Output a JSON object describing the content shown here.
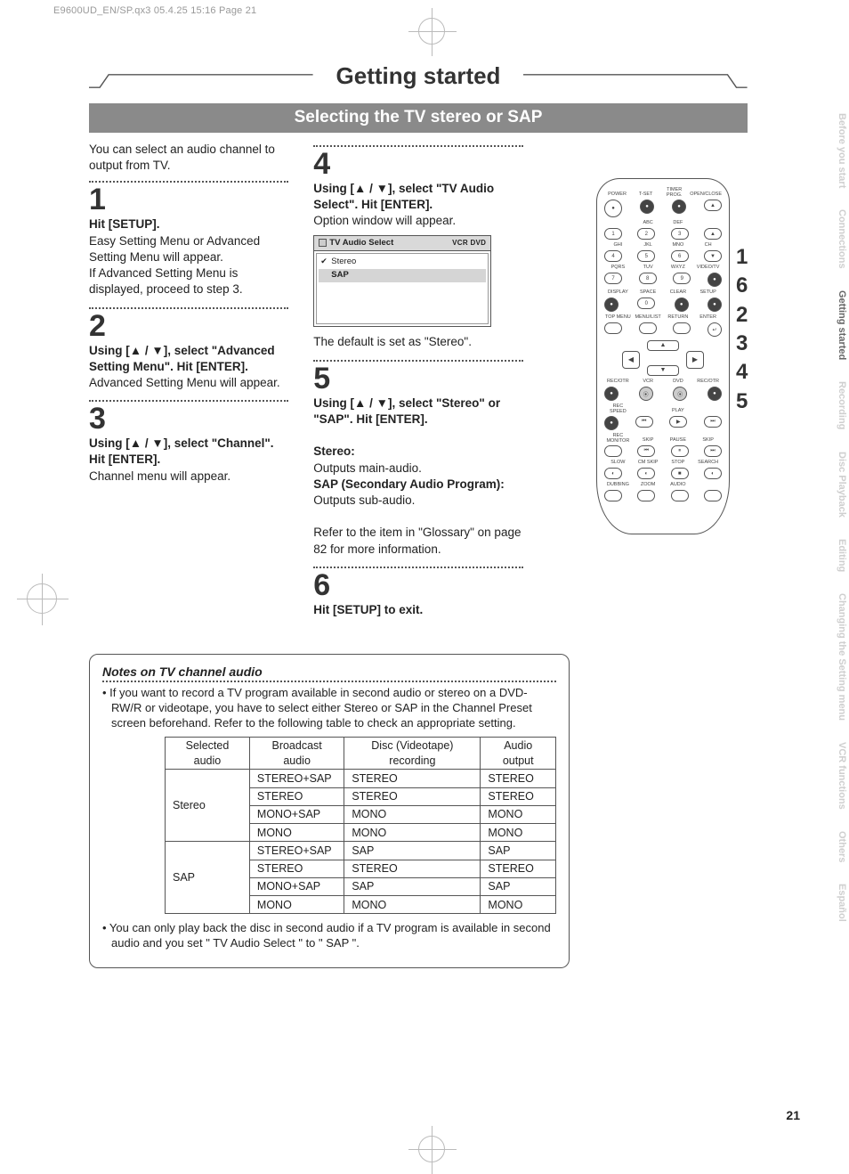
{
  "print_header": "E9600UD_EN/SP.qx3  05.4.25 15:16  Page 21",
  "title": "Getting started",
  "subtitle": "Selecting the TV stereo or SAP",
  "intro": "You can select an audio channel to output from TV.",
  "steps_left": [
    {
      "num": "1",
      "bold": "Hit [SETUP].",
      "body": "Easy Setting Menu or Advanced Setting Menu will appear.\nIf Advanced Setting Menu is displayed, proceed to step 3."
    },
    {
      "num": "2",
      "bold": "Using [▲ / ▼], select \"Advanced Setting Menu\". Hit [ENTER].",
      "body": "Advanced Setting Menu will appear."
    },
    {
      "num": "3",
      "bold": "Using [▲ / ▼], select \"Channel\". Hit [ENTER].",
      "body": "Channel menu will appear."
    }
  ],
  "steps_right": [
    {
      "num": "4",
      "bold": "Using [▲ / ▼], select \"TV Audio Select\". Hit [ENTER].",
      "body_before": "Option window will appear.",
      "osd": {
        "title": "TV Audio Select",
        "badges": "VCR  DVD",
        "rows": [
          {
            "label": "Stereo",
            "selected": true
          },
          {
            "label": "SAP",
            "selected": false,
            "highlight": true
          }
        ]
      },
      "body_after": "The default is set as \"Stereo\"."
    },
    {
      "num": "5",
      "bold": "Using [▲ / ▼], select \"Stereo\" or \"SAP\". Hit [ENTER].",
      "extra": [
        {
          "head": "Stereo:",
          "text": "Outputs main-audio."
        },
        {
          "head": "SAP (Secondary Audio Program):",
          "text": "Outputs sub-audio."
        }
      ],
      "tail": "Refer to the item in \"Glossary\" on page 82 for more information."
    },
    {
      "num": "6",
      "bold": "Hit [SETUP] to exit."
    }
  ],
  "remote": {
    "rows_labels": [
      [
        "POWER",
        "T-SET",
        "TIMER PROG.",
        "OPEN/CLOSE"
      ],
      [
        "",
        "ABC",
        "DEF",
        ""
      ],
      [
        "GHI",
        "JKL",
        "MNO",
        "CH"
      ],
      [
        "PQRS",
        "TUV",
        "WXYZ",
        "VIDEO/TV"
      ],
      [
        "DISPLAY",
        "SPACE",
        "CLEAR",
        "SETUP"
      ],
      [
        "TOP MENU",
        "MENU/LIST",
        "RETURN",
        "ENTER"
      ]
    ],
    "num_rows": [
      [
        "●",
        "●",
        "●",
        "▲"
      ],
      [
        "1",
        "2",
        "3",
        "▲"
      ],
      [
        "4",
        "5",
        "6",
        "▼"
      ],
      [
        "7",
        "8",
        "9",
        "●"
      ],
      [
        "●",
        "0",
        "●",
        "●"
      ],
      [
        " ",
        " ",
        " ",
        "↵"
      ]
    ],
    "dpad": {
      "up": "▲",
      "down": "▼",
      "left": "◀",
      "right": "▶"
    },
    "section2_labels": [
      [
        "REC/OTR",
        "VCR",
        "DVD",
        "REC/OTR"
      ],
      [
        "REC SPEED",
        "",
        "PLAY",
        ""
      ],
      [
        "REC MONITOR",
        "SKIP",
        "PAUSE",
        "SKIP"
      ],
      [
        "SLOW",
        "CM SKIP",
        "STOP",
        "SEARCH"
      ],
      [
        "DUBBING",
        "ZOOM",
        "AUDIO",
        ""
      ]
    ],
    "section2_btns": [
      [
        "●",
        "⦿",
        "⦿",
        "●"
      ],
      [
        "●",
        "⏮",
        "▶",
        "⏭"
      ],
      [
        " ",
        "⏮",
        "⏸",
        "⏭"
      ],
      [
        "◐",
        "◐",
        "■",
        "◐"
      ],
      [
        "",
        "",
        "",
        " "
      ]
    ]
  },
  "callouts": [
    "1",
    "6",
    "2",
    "3",
    "4",
    "5"
  ],
  "side_tabs": [
    {
      "label": "Before you start",
      "active": false
    },
    {
      "label": "Connections",
      "active": false
    },
    {
      "label": "Getting started",
      "active": true
    },
    {
      "label": "Recording",
      "active": false
    },
    {
      "label": "Disc Playback",
      "active": false
    },
    {
      "label": "Editing",
      "active": false
    },
    {
      "label": "Changing the Setting menu",
      "active": false
    },
    {
      "label": "VCR functions",
      "active": false
    },
    {
      "label": "Others",
      "active": false
    },
    {
      "label": "Español",
      "active": false
    }
  ],
  "notes": {
    "title": "Notes on TV channel audio",
    "bullet1": "• If you want to record a TV program available in second audio or stereo on a DVD-RW/R or videotape, you have to select either Stereo or SAP in the Channel Preset screen beforehand. Refer to the following table to check an appropriate setting.",
    "table": {
      "headers": [
        "Selected audio",
        "Broadcast audio",
        "Disc (Videotape) recording",
        "Audio output"
      ],
      "rows": [
        [
          "Stereo",
          "STEREO+SAP",
          "STEREO",
          "STEREO"
        ],
        [
          "",
          "STEREO",
          "STEREO",
          "STEREO"
        ],
        [
          "",
          "MONO+SAP",
          "MONO",
          "MONO"
        ],
        [
          "",
          "MONO",
          "MONO",
          "MONO"
        ],
        [
          "SAP",
          "STEREO+SAP",
          "SAP",
          "SAP"
        ],
        [
          "",
          "STEREO",
          "STEREO",
          "STEREO"
        ],
        [
          "",
          "MONO+SAP",
          "SAP",
          "SAP"
        ],
        [
          "",
          "MONO",
          "MONO",
          "MONO"
        ]
      ]
    },
    "bullet2": "• You can only play back the disc in second audio if a TV program is available in second audio and you set \" TV Audio Select \" to \" SAP \"."
  },
  "page_number": "21"
}
